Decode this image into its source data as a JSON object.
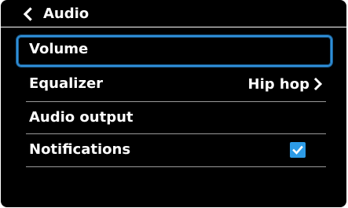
{
  "header": {
    "title": "Audio",
    "back_icon": "chevron-left-icon"
  },
  "menu": {
    "items": [
      {
        "label": "Volume",
        "focused": true
      },
      {
        "label": "Equalizer",
        "value": "Hip hop",
        "value_icon": "chevron-right-icon"
      },
      {
        "label": "Audio output"
      },
      {
        "label": "Notifications",
        "checked": true
      }
    ]
  },
  "colors": {
    "background": "#000000",
    "text": "#ffffff",
    "focus_border": "#2f8fd8",
    "checkbox": "#2d9be6",
    "divider": "#9a9a9a"
  }
}
